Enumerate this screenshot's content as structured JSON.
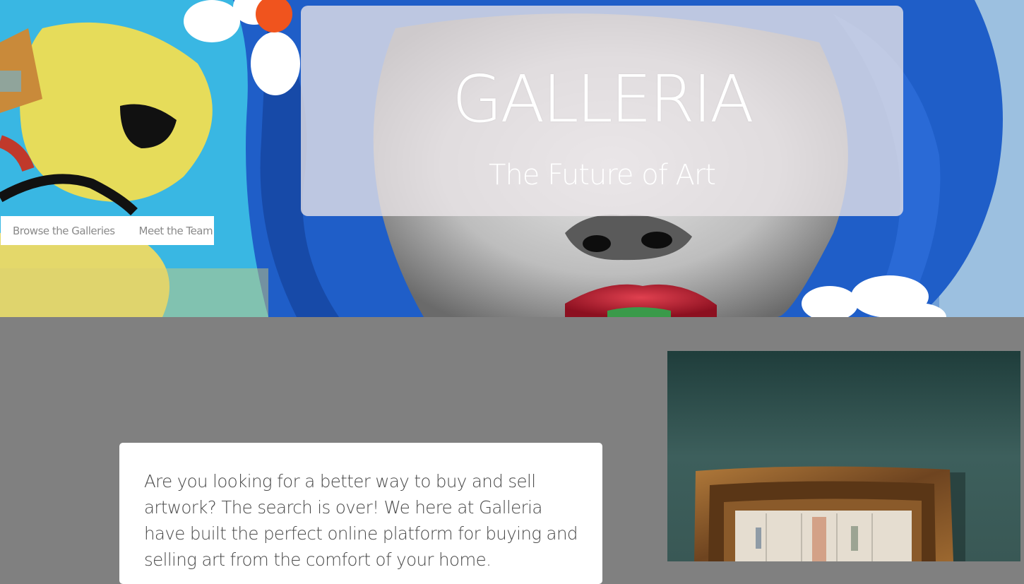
{
  "hero": {
    "title": "GALLERIA",
    "subtitle": "The Future of Art",
    "image": "street-art-mural-photo"
  },
  "nav": {
    "items": [
      {
        "label": "Browse the Galleries"
      },
      {
        "label": "Meet the Team"
      }
    ]
  },
  "about": {
    "text": "Are you looking for a better way to buy and sell artwork? The search is over! We here at Galleria have built the perfect online platform for buying and selling art from the comfort of your home.",
    "image": "framed-painting-photo"
  },
  "colors": {
    "section_bg": "#808080",
    "card_bg": "#ffffff",
    "nav_text": "#8a8a8a",
    "body_text": "#4a4a4a"
  }
}
